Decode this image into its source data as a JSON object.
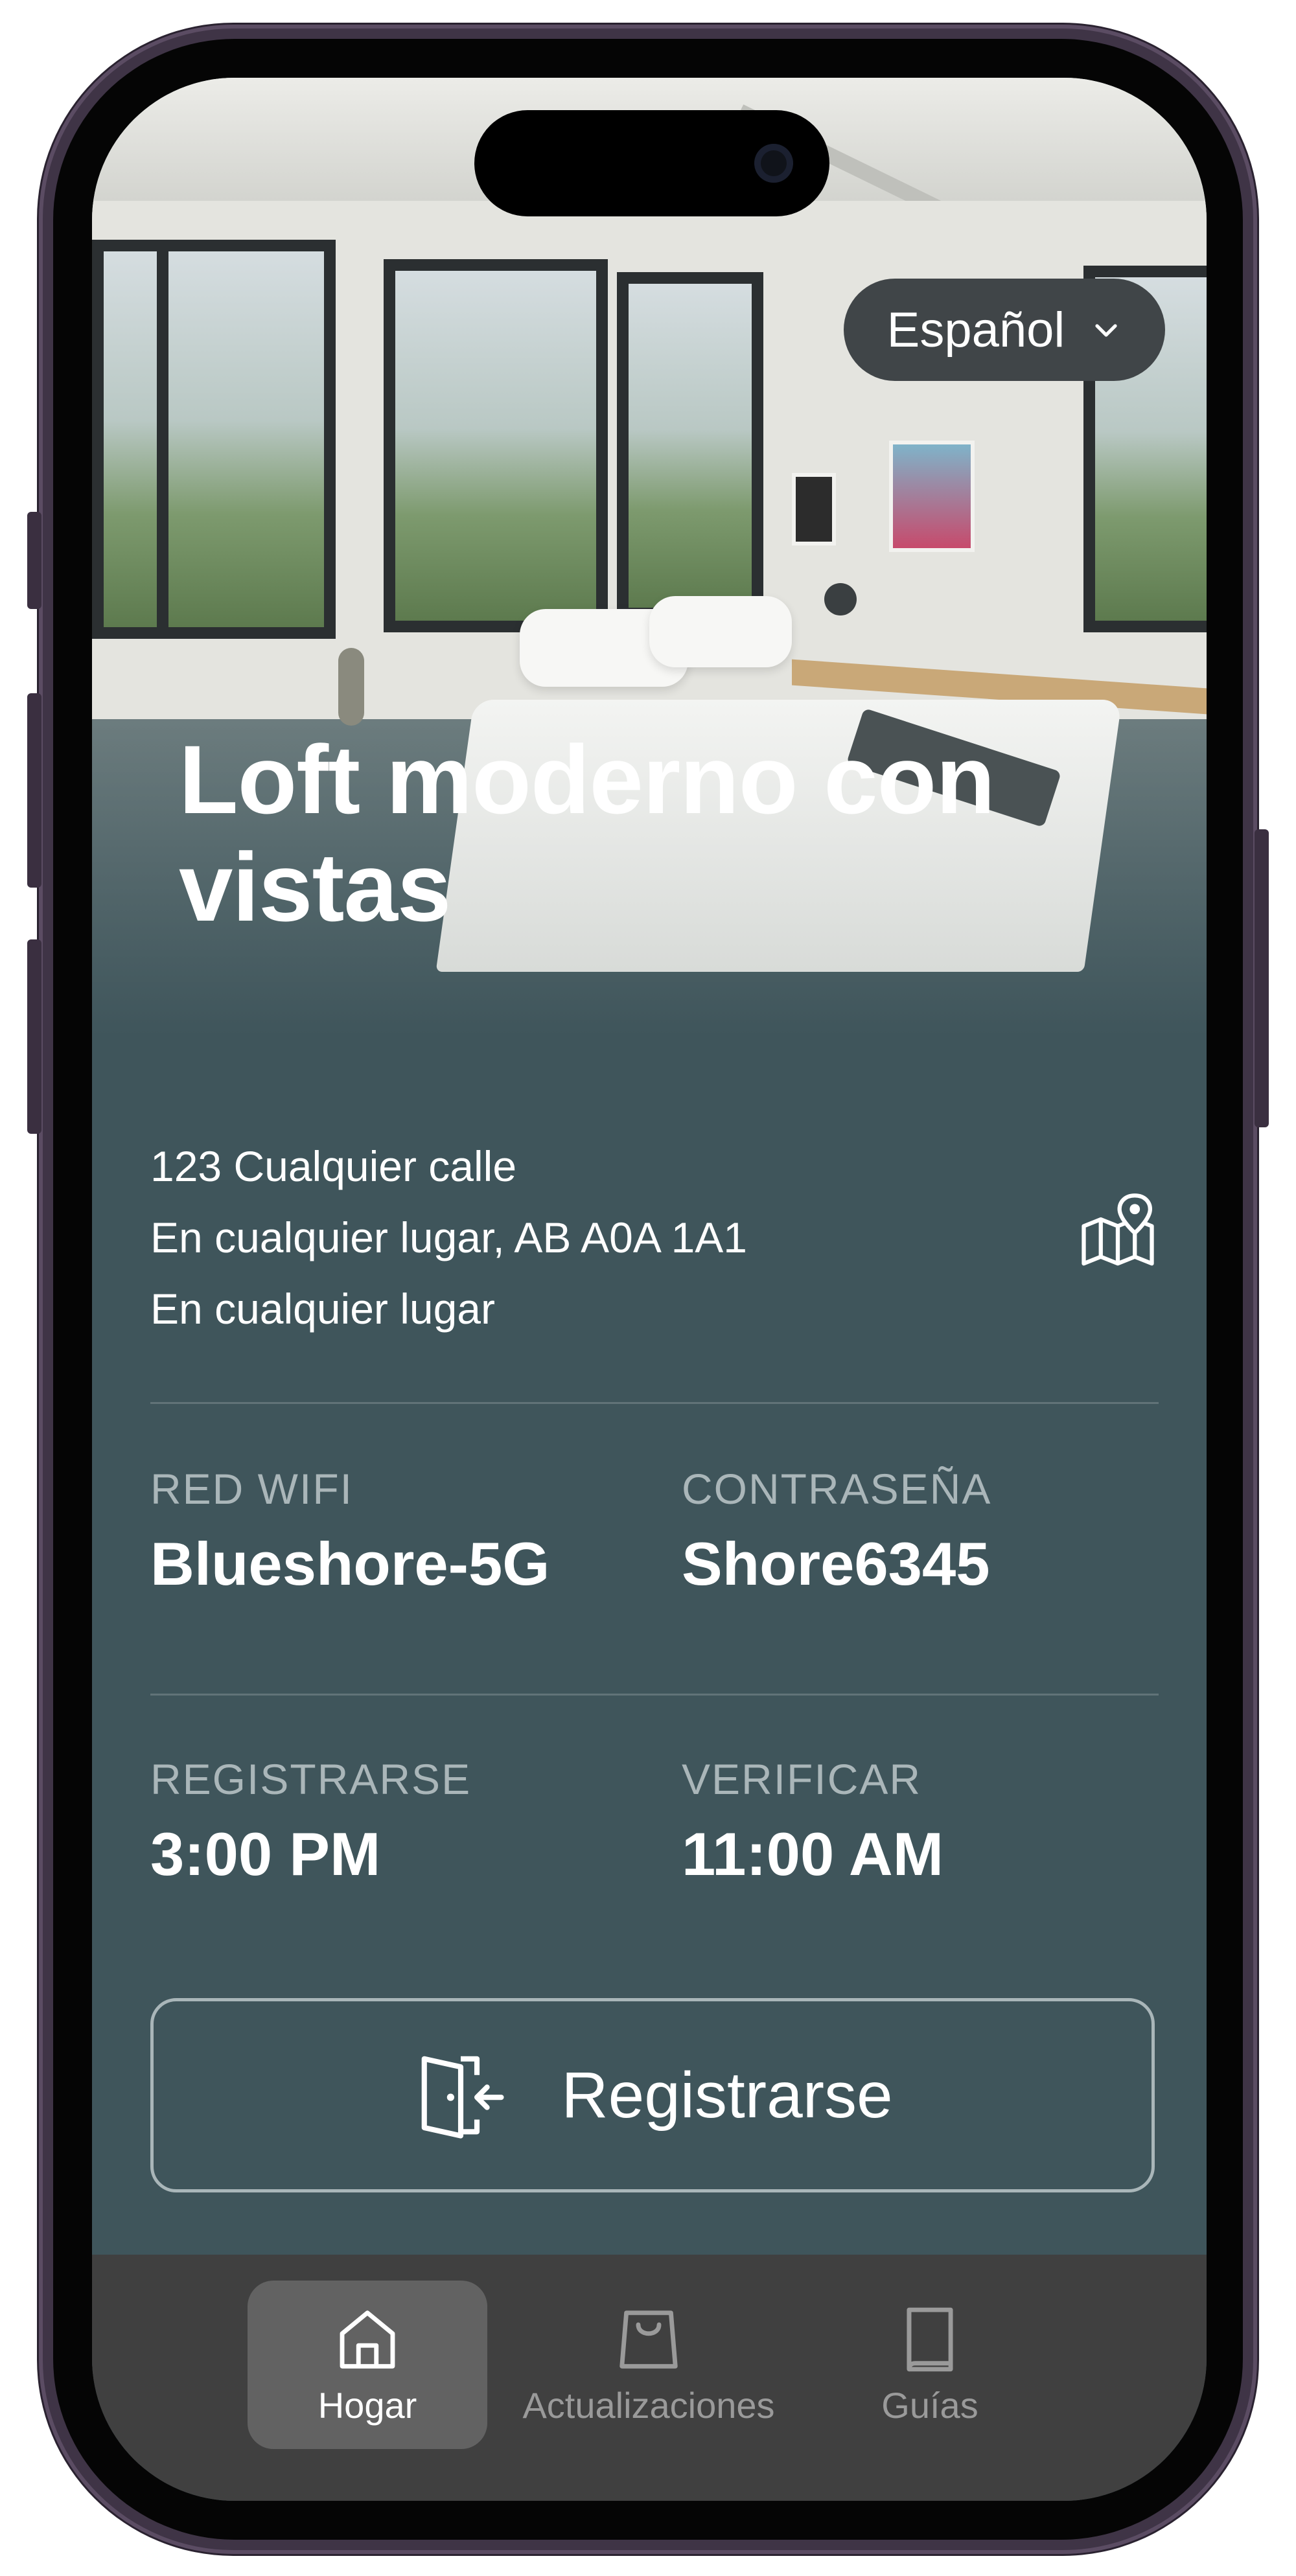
{
  "property": {
    "title": "Loft moderno con vistas",
    "address_lines": [
      "123 Cualquier calle",
      "En cualquier lugar, AB A0A 1A1",
      "En cualquier lugar"
    ]
  },
  "language": {
    "selected": "Español",
    "icon": "chevron-down-icon"
  },
  "wifi": {
    "network_label": "RED WIFI",
    "network_value": "Blueshore-5G",
    "password_label": "CONTRASEÑA",
    "password_value": "Shore6345"
  },
  "stay": {
    "checkin_label": "REGISTRARSE",
    "checkin_value": "3:00 PM",
    "checkout_label": "VERIFICAR",
    "checkout_value": "11:00 AM"
  },
  "actions": {
    "checkin_button": "Registrarse",
    "checkin_icon": "door-enter-icon",
    "map_icon": "map-pin-icon"
  },
  "tabs": [
    {
      "label": "Hogar",
      "icon": "home-icon",
      "active": true
    },
    {
      "label": "Actualizaciones",
      "icon": "shopping-bag-icon",
      "active": false
    },
    {
      "label": "Guías",
      "icon": "book-icon",
      "active": false
    }
  ],
  "colors": {
    "background": "#3f555b",
    "tabbar": "#404040",
    "active_tab": "#626262",
    "label": "#aab6b9"
  }
}
